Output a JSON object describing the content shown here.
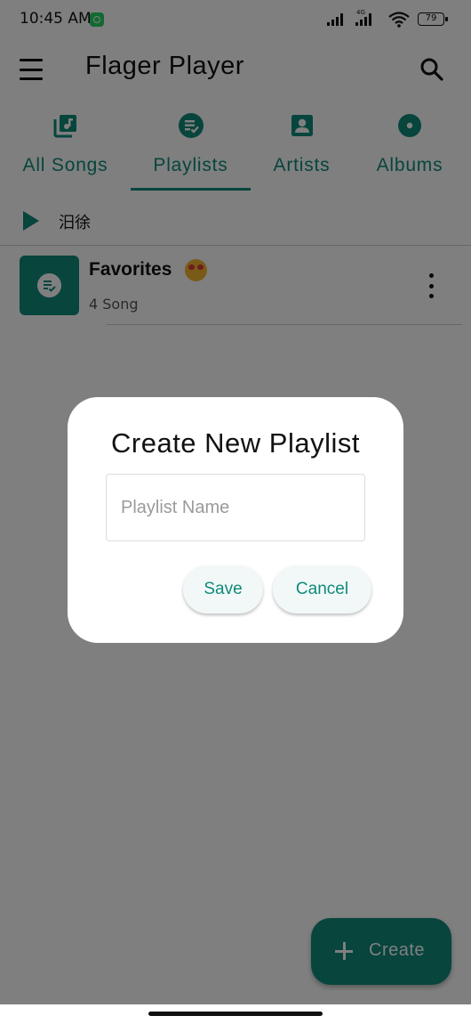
{
  "status_bar": {
    "time": "10:45 AM",
    "network_label": "4G",
    "battery": "79",
    "notification_icon": "whatsapp-icon"
  },
  "app_bar": {
    "title": "Flager Player",
    "menu_icon": "hamburger-menu-icon",
    "search_icon": "search-icon"
  },
  "tabs": [
    {
      "label": "All Songs",
      "icon": "music-library-icon",
      "selected": false
    },
    {
      "label": "Playlists",
      "icon": "playlist-check-icon",
      "selected": true
    },
    {
      "label": "Artists",
      "icon": "account-box-icon",
      "selected": false
    },
    {
      "label": "Albums",
      "icon": "album-icon",
      "selected": false
    }
  ],
  "play_row": {
    "label": "汨徐",
    "icon": "play-icon"
  },
  "playlists": [
    {
      "name": "Favorites",
      "emoji": "heart-eyes-emoji",
      "count": "4 Song"
    }
  ],
  "fab": {
    "label": "Create",
    "icon": "plus-icon"
  },
  "dialog": {
    "title": "Create New Playlist",
    "input_placeholder": "Playlist Name",
    "input_value": "",
    "save_label": "Save",
    "cancel_label": "Cancel"
  },
  "colors": {
    "accent": "#0f8a7b",
    "scrim": "rgba(0,0,0,0.5)",
    "dialog_background": "#ffffff",
    "button_background": "#f2f8f7"
  }
}
